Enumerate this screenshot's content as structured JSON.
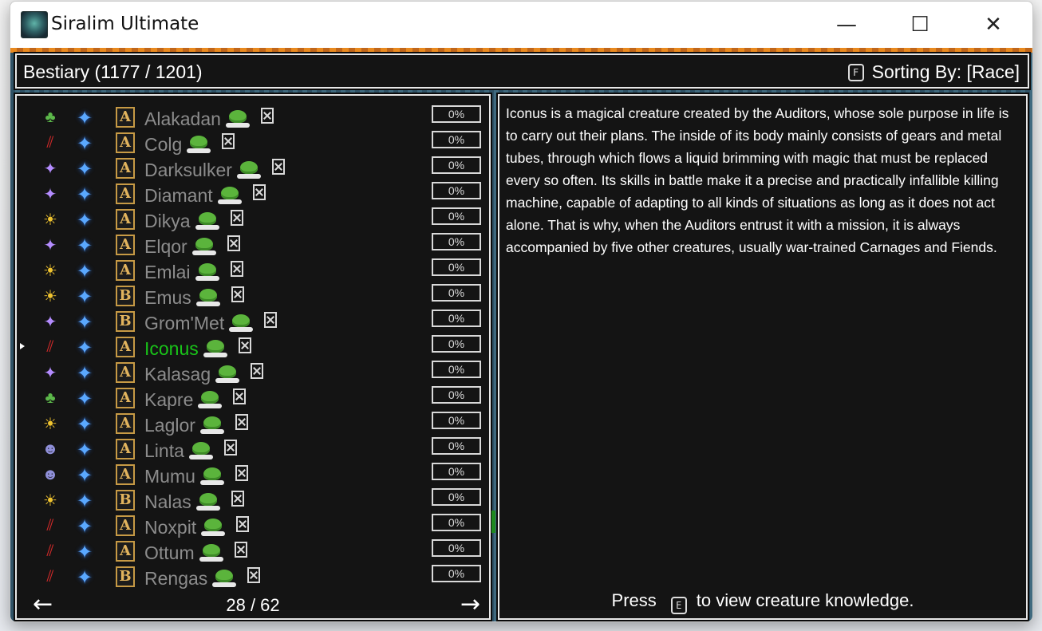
{
  "window": {
    "title": "Siralim Ultimate",
    "minimize": "—",
    "maximize": "☐",
    "close": "✕"
  },
  "header": {
    "title": "Bestiary (1177 / 1201)",
    "sort_key": "F",
    "sort_label": "Sorting By: [Race]"
  },
  "list": {
    "rows": [
      {
        "race": "♣",
        "race_color": "#5cb84a",
        "tier": "A",
        "name": "Alakadan",
        "pct": "0%"
      },
      {
        "race": "⫽",
        "race_color": "#d42a2a",
        "tier": "A",
        "name": "Colg",
        "pct": "0%"
      },
      {
        "race": "✦",
        "race_color": "#b48cff",
        "tier": "A",
        "name": "Darksulker",
        "pct": "0%"
      },
      {
        "race": "✦",
        "race_color": "#b48cff",
        "tier": "A",
        "name": "Diamant",
        "pct": "0%"
      },
      {
        "race": "☀",
        "race_color": "#f0c430",
        "tier": "A",
        "name": "Dikya",
        "pct": "0%"
      },
      {
        "race": "✦",
        "race_color": "#b48cff",
        "tier": "A",
        "name": "Elqor",
        "pct": "0%"
      },
      {
        "race": "☀",
        "race_color": "#f0c430",
        "tier": "A",
        "name": "Emlai",
        "pct": "0%"
      },
      {
        "race": "☀",
        "race_color": "#f0c430",
        "tier": "B",
        "name": "Emus",
        "pct": "0%"
      },
      {
        "race": "✦",
        "race_color": "#b48cff",
        "tier": "B",
        "name": "Grom'Met",
        "pct": "0%"
      },
      {
        "race": "⫽",
        "race_color": "#d42a2a",
        "tier": "A",
        "name": "Iconus",
        "pct": "0%",
        "selected": true
      },
      {
        "race": "✦",
        "race_color": "#b48cff",
        "tier": "A",
        "name": "Kalasag",
        "pct": "0%"
      },
      {
        "race": "♣",
        "race_color": "#5cb84a",
        "tier": "A",
        "name": "Kapre",
        "pct": "0%"
      },
      {
        "race": "☀",
        "race_color": "#f0c430",
        "tier": "A",
        "name": "Laglor",
        "pct": "0%"
      },
      {
        "race": "☻",
        "race_color": "#8f8fd8",
        "tier": "A",
        "name": "Linta",
        "pct": "0%"
      },
      {
        "race": "☻",
        "race_color": "#8f8fd8",
        "tier": "A",
        "name": "Mumu",
        "pct": "0%"
      },
      {
        "race": "☀",
        "race_color": "#f0c430",
        "tier": "B",
        "name": "Nalas",
        "pct": "0%"
      },
      {
        "race": "⫽",
        "race_color": "#d42a2a",
        "tier": "A",
        "name": "Noxpit",
        "pct": "0%"
      },
      {
        "race": "⫽",
        "race_color": "#d42a2a",
        "tier": "A",
        "name": "Ottum",
        "pct": "0%"
      },
      {
        "race": "⫽",
        "race_color": "#d42a2a",
        "tier": "B",
        "name": "Rengas",
        "pct": "0%"
      }
    ],
    "page": "28 / 62",
    "prev": "←",
    "next": "→"
  },
  "description": {
    "text": "Iconus is a magical creature created by the Auditors, whose sole purpose in life is to carry out their plans. The inside of its body mainly consists of gears and metal tubes, through which flows a liquid brimming with magic that must be replaced every so often. Its skills in battle make it a precise and practically infallible killing machine, capable of adapting to all kinds of situations as long as it does not act alone. That is why, when the Auditors entrust it with a mission, it is always accompanied by five other creatures, usually war-trained Carnages and Fiends.",
    "hint_press": "Press",
    "hint_key": "E",
    "hint_rest": "to view creature knowledge."
  }
}
